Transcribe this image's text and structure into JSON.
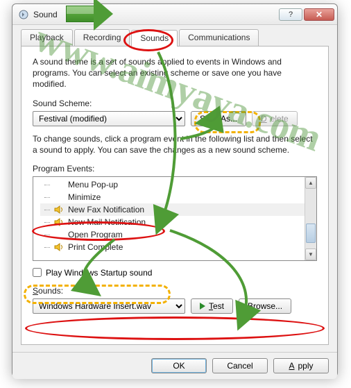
{
  "window": {
    "title": "Sound"
  },
  "tabs": [
    "Playback",
    "Recording",
    "Sounds",
    "Communications"
  ],
  "active_tab_index": 2,
  "description": "A sound theme is a set of sounds applied to events in Windows and programs.  You can select an existing scheme or save one you have modified.",
  "scheme": {
    "label": "Sound Scheme:",
    "value": "Festival (modified)",
    "save_as": "Save As...",
    "delete": "Delete"
  },
  "events": {
    "intro": "To change sounds, click a program event in the following list and then select a sound to apply.  You can save the changes as a new sound scheme.",
    "label": "Program Events:",
    "items": [
      {
        "label": "Menu Pop-up",
        "has_sound": false
      },
      {
        "label": "Minimize",
        "has_sound": false
      },
      {
        "label": "New Fax Notification",
        "has_sound": true,
        "selected": true
      },
      {
        "label": "New Mail Notification",
        "has_sound": true
      },
      {
        "label": "Open Program",
        "has_sound": false
      },
      {
        "label": "Print Complete",
        "has_sound": true
      }
    ]
  },
  "startup": {
    "label": "Play Windows Startup sound",
    "checked": false
  },
  "sounds": {
    "label": "Sounds:",
    "value": "Windows Hardware Insert.wav",
    "test": "Test",
    "browse": "Browse..."
  },
  "footer": {
    "ok": "OK",
    "cancel": "Cancel",
    "apply": "Apply"
  },
  "watermark": "www.aimyaya.com",
  "colors": {
    "red": "#d11",
    "orange": "#f3b100",
    "green": "#4f9c36"
  }
}
